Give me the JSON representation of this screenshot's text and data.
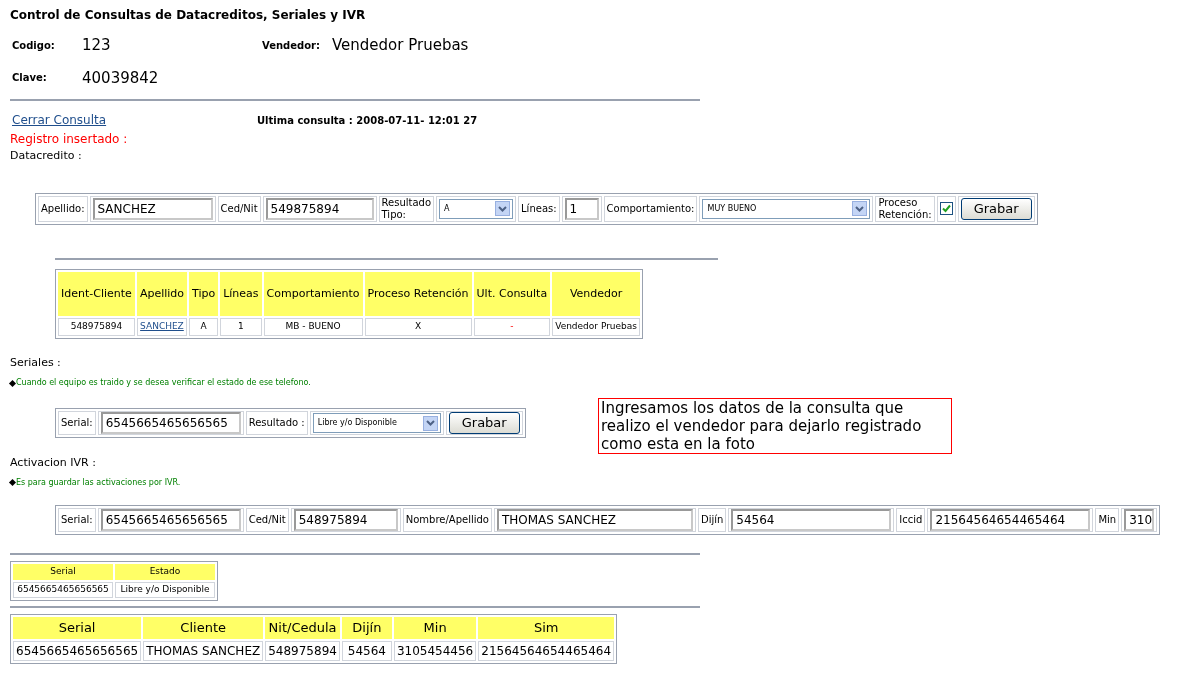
{
  "title": "Control de Consultas de Datacreditos, Seriales y IVR",
  "header_fields": [
    {
      "label": "Codigo:",
      "value": "123"
    },
    {
      "label": "Vendedor:",
      "value": "Vendedor Pruebas"
    },
    {
      "label": "Clave:",
      "value": "40039842"
    }
  ],
  "close_link": "Cerrar Consulta",
  "last_query": "Ultima consulta : 2008-07-11- 12:01 27",
  "status_message": "Registro insertado :",
  "datacredito": {
    "heading": "Datacredito :",
    "form": [
      {
        "kind": "label",
        "text": "Apellido:"
      },
      {
        "kind": "text",
        "value": "SANCHEZ"
      },
      {
        "kind": "label",
        "text": "Ced/Nit"
      },
      {
        "kind": "text",
        "value": "549875894"
      },
      {
        "kind": "label",
        "text": "Resultado\nTipo:"
      },
      {
        "kind": "select",
        "value": "A"
      },
      {
        "kind": "label",
        "text": "Líneas:"
      },
      {
        "kind": "text",
        "value": "1"
      },
      {
        "kind": "label",
        "text": "Comportamiento:"
      },
      {
        "kind": "select",
        "value": "MUY BUENO"
      },
      {
        "kind": "label",
        "text": "Proceso\nRetención:"
      },
      {
        "kind": "checkbox",
        "checked": true
      },
      {
        "kind": "button",
        "text": "Grabar"
      }
    ],
    "table": {
      "columns": [
        "Ident-Cliente",
        "Apellido",
        "Tipo",
        "Líneas",
        "Comportamiento",
        "Proceso Retención",
        "Ult. Consulta",
        "Vendedor"
      ],
      "rows": [
        [
          {
            "text": "548975894"
          },
          {
            "text": "SANCHEZ",
            "link": true
          },
          {
            "text": "A"
          },
          {
            "text": "1"
          },
          {
            "text": "MB - BUENO"
          },
          {
            "text": "X"
          },
          {
            "text": "-",
            "alert": true
          },
          {
            "text": "Vendedor Pruebas"
          }
        ]
      ]
    }
  },
  "seriales": {
    "heading": "Seriales :",
    "note": "Cuando el equipo es traido y se desea verificar el estado de ese telefono.",
    "form": [
      {
        "kind": "label",
        "text": "Serial:"
      },
      {
        "kind": "text",
        "value": "6545665465656565"
      },
      {
        "kind": "label",
        "text": "Resultado :"
      },
      {
        "kind": "select",
        "value": "Libre y/o Disponible"
      },
      {
        "kind": "button",
        "text": "Grabar"
      }
    ],
    "callout": "Ingresamos los datos de la consulta que realizo el vendedor para dejarlo registrado como esta en la foto"
  },
  "ivr": {
    "heading": "Activacion IVR :",
    "note": "Es para guardar las activaciones por IVR.",
    "form": [
      {
        "kind": "label",
        "text": "Serial:"
      },
      {
        "kind": "text",
        "value": "6545665465656565"
      },
      {
        "kind": "label",
        "text": "Ced/Nit"
      },
      {
        "kind": "text",
        "value": "548975894"
      },
      {
        "kind": "label",
        "text": "Nombre/Apellido"
      },
      {
        "kind": "text",
        "value": "THOMAS SANCHEZ"
      },
      {
        "kind": "label",
        "text": "Dijín"
      },
      {
        "kind": "text",
        "value": "54564"
      },
      {
        "kind": "label",
        "text": "Iccid"
      },
      {
        "kind": "text",
        "value": "21564564654465464"
      },
      {
        "kind": "label",
        "text": "Min"
      },
      {
        "kind": "text",
        "value": "310"
      }
    ]
  },
  "serial_table": {
    "columns": [
      "Serial",
      "Estado"
    ],
    "rows": [
      [
        "6545665465656565",
        "Libre y/o Disponible"
      ]
    ]
  },
  "activation_table": {
    "columns": [
      "Serial",
      "Cliente",
      "Nit/Cedula",
      "Dijín",
      "Min",
      "Sim"
    ],
    "rows": [
      [
        "6545665465656565",
        "THOMAS SANCHEZ",
        "548975894",
        "54564",
        "3105454456",
        "21564564654465464"
      ]
    ]
  }
}
